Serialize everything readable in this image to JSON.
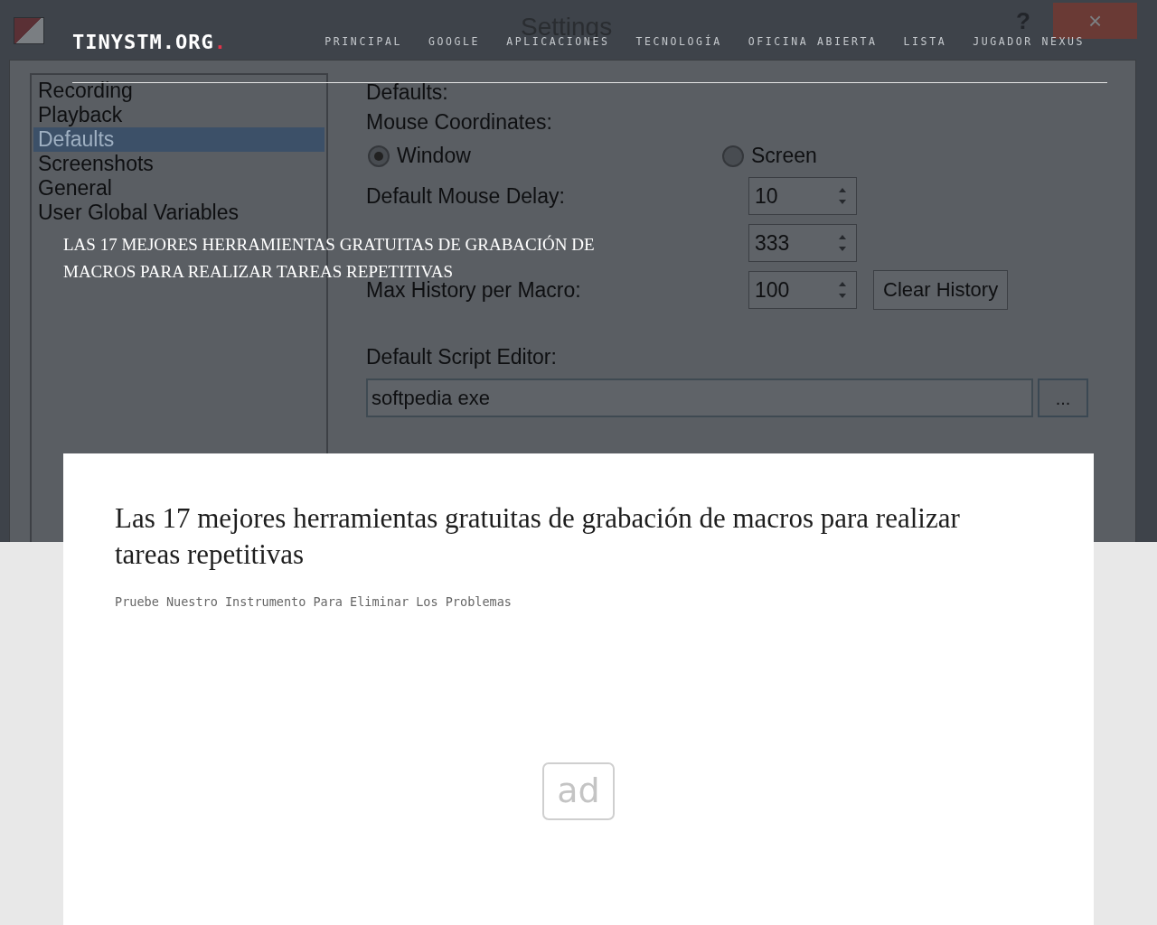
{
  "site": {
    "logo": "TINYSTM.ORG",
    "logo_dot": "."
  },
  "nav": [
    {
      "label": "PRINCIPAL"
    },
    {
      "label": "GOOGLE"
    },
    {
      "label": "APLICACIONES"
    },
    {
      "label": "TECNOLOGÍA"
    },
    {
      "label": "OFICINA ABIERTA"
    },
    {
      "label": "LISTA"
    },
    {
      "label": "JUGADOR NEXUS"
    }
  ],
  "hero": {
    "title": "LAS 17 MEJORES HERRAMIENTAS GRATUITAS DE GRABACIÓN DE MACROS PARA REALIZAR TAREAS REPETITIVAS",
    "window": {
      "title": "Settings",
      "help": "?",
      "close": "×",
      "list": [
        {
          "label": "Recording",
          "selected": false
        },
        {
          "label": "Playback",
          "selected": false
        },
        {
          "label": "Defaults",
          "selected": true
        },
        {
          "label": "Screenshots",
          "selected": false
        },
        {
          "label": "General",
          "selected": false
        },
        {
          "label": "User Global Variables",
          "selected": false
        }
      ],
      "section": "Defaults:",
      "mouse_coordinates": {
        "label": "Mouse Coordinates:",
        "options": [
          {
            "label": "Window",
            "selected": true
          },
          {
            "label": "Screen",
            "selected": false
          }
        ]
      },
      "spins": [
        {
          "label": "Default Mouse Delay:",
          "value": "10"
        },
        {
          "value": "333"
        },
        {
          "label": "Max History per Macro:",
          "value": "100",
          "button": "Clear History"
        }
      ],
      "script_editor": {
        "label": "Default Script Editor:",
        "value": "softpedia exe",
        "browse": "..."
      }
    }
  },
  "article": {
    "title": "Las 17 mejores herramientas gratuitas de grabación de macros para realizar tareas repetitivas",
    "subtitle": "Pruebe Nuestro Instrumento Para Eliminar Los Problemas",
    "ad": "ad"
  }
}
